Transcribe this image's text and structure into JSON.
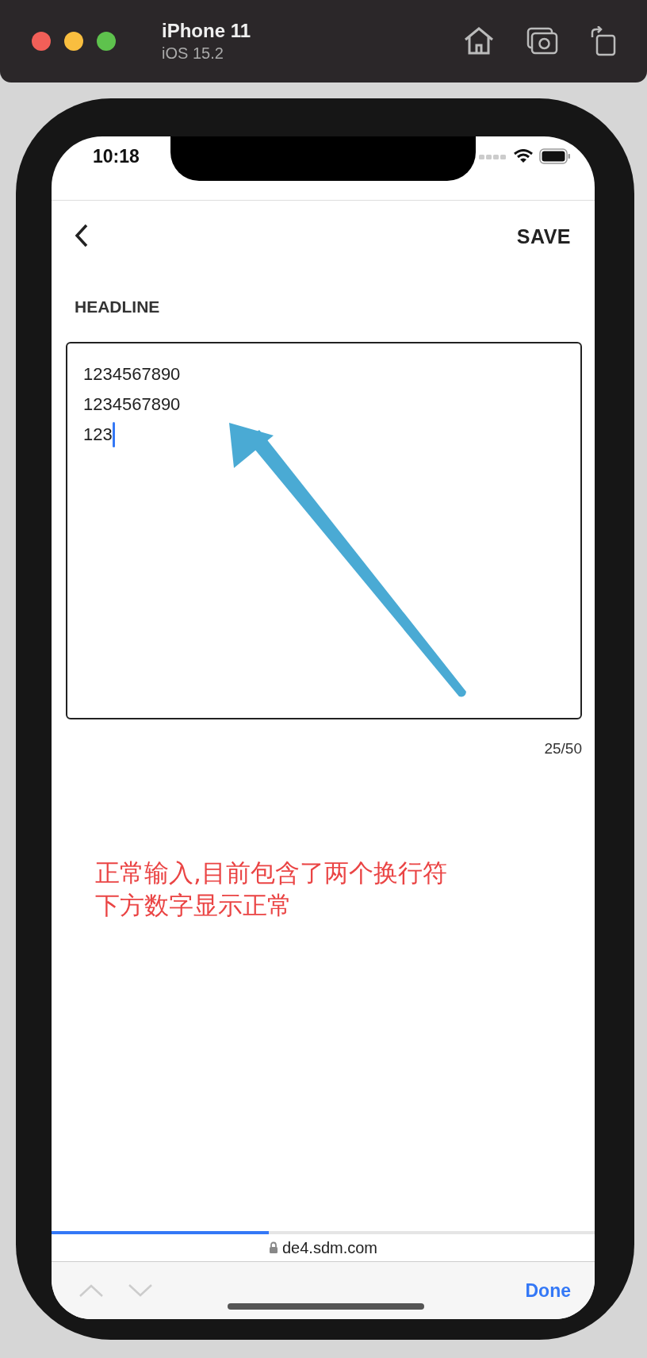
{
  "simulator": {
    "title": "iPhone 11",
    "subtitle": "iOS 15.2"
  },
  "status_bar": {
    "time": "10:18"
  },
  "nav": {
    "action": "SAVE"
  },
  "form": {
    "label": "HEADLINE",
    "lines": [
      "1234567890",
      "1234567890",
      "123"
    ],
    "focused": true,
    "counter": "25/50"
  },
  "annotation": {
    "lines": [
      "正常输入,目前包含了两个换行符",
      "下方数字显示正常"
    ]
  },
  "browser": {
    "progress": {
      "level": 0.4
    },
    "url": "de4.sdm.com",
    "done": "Done"
  }
}
